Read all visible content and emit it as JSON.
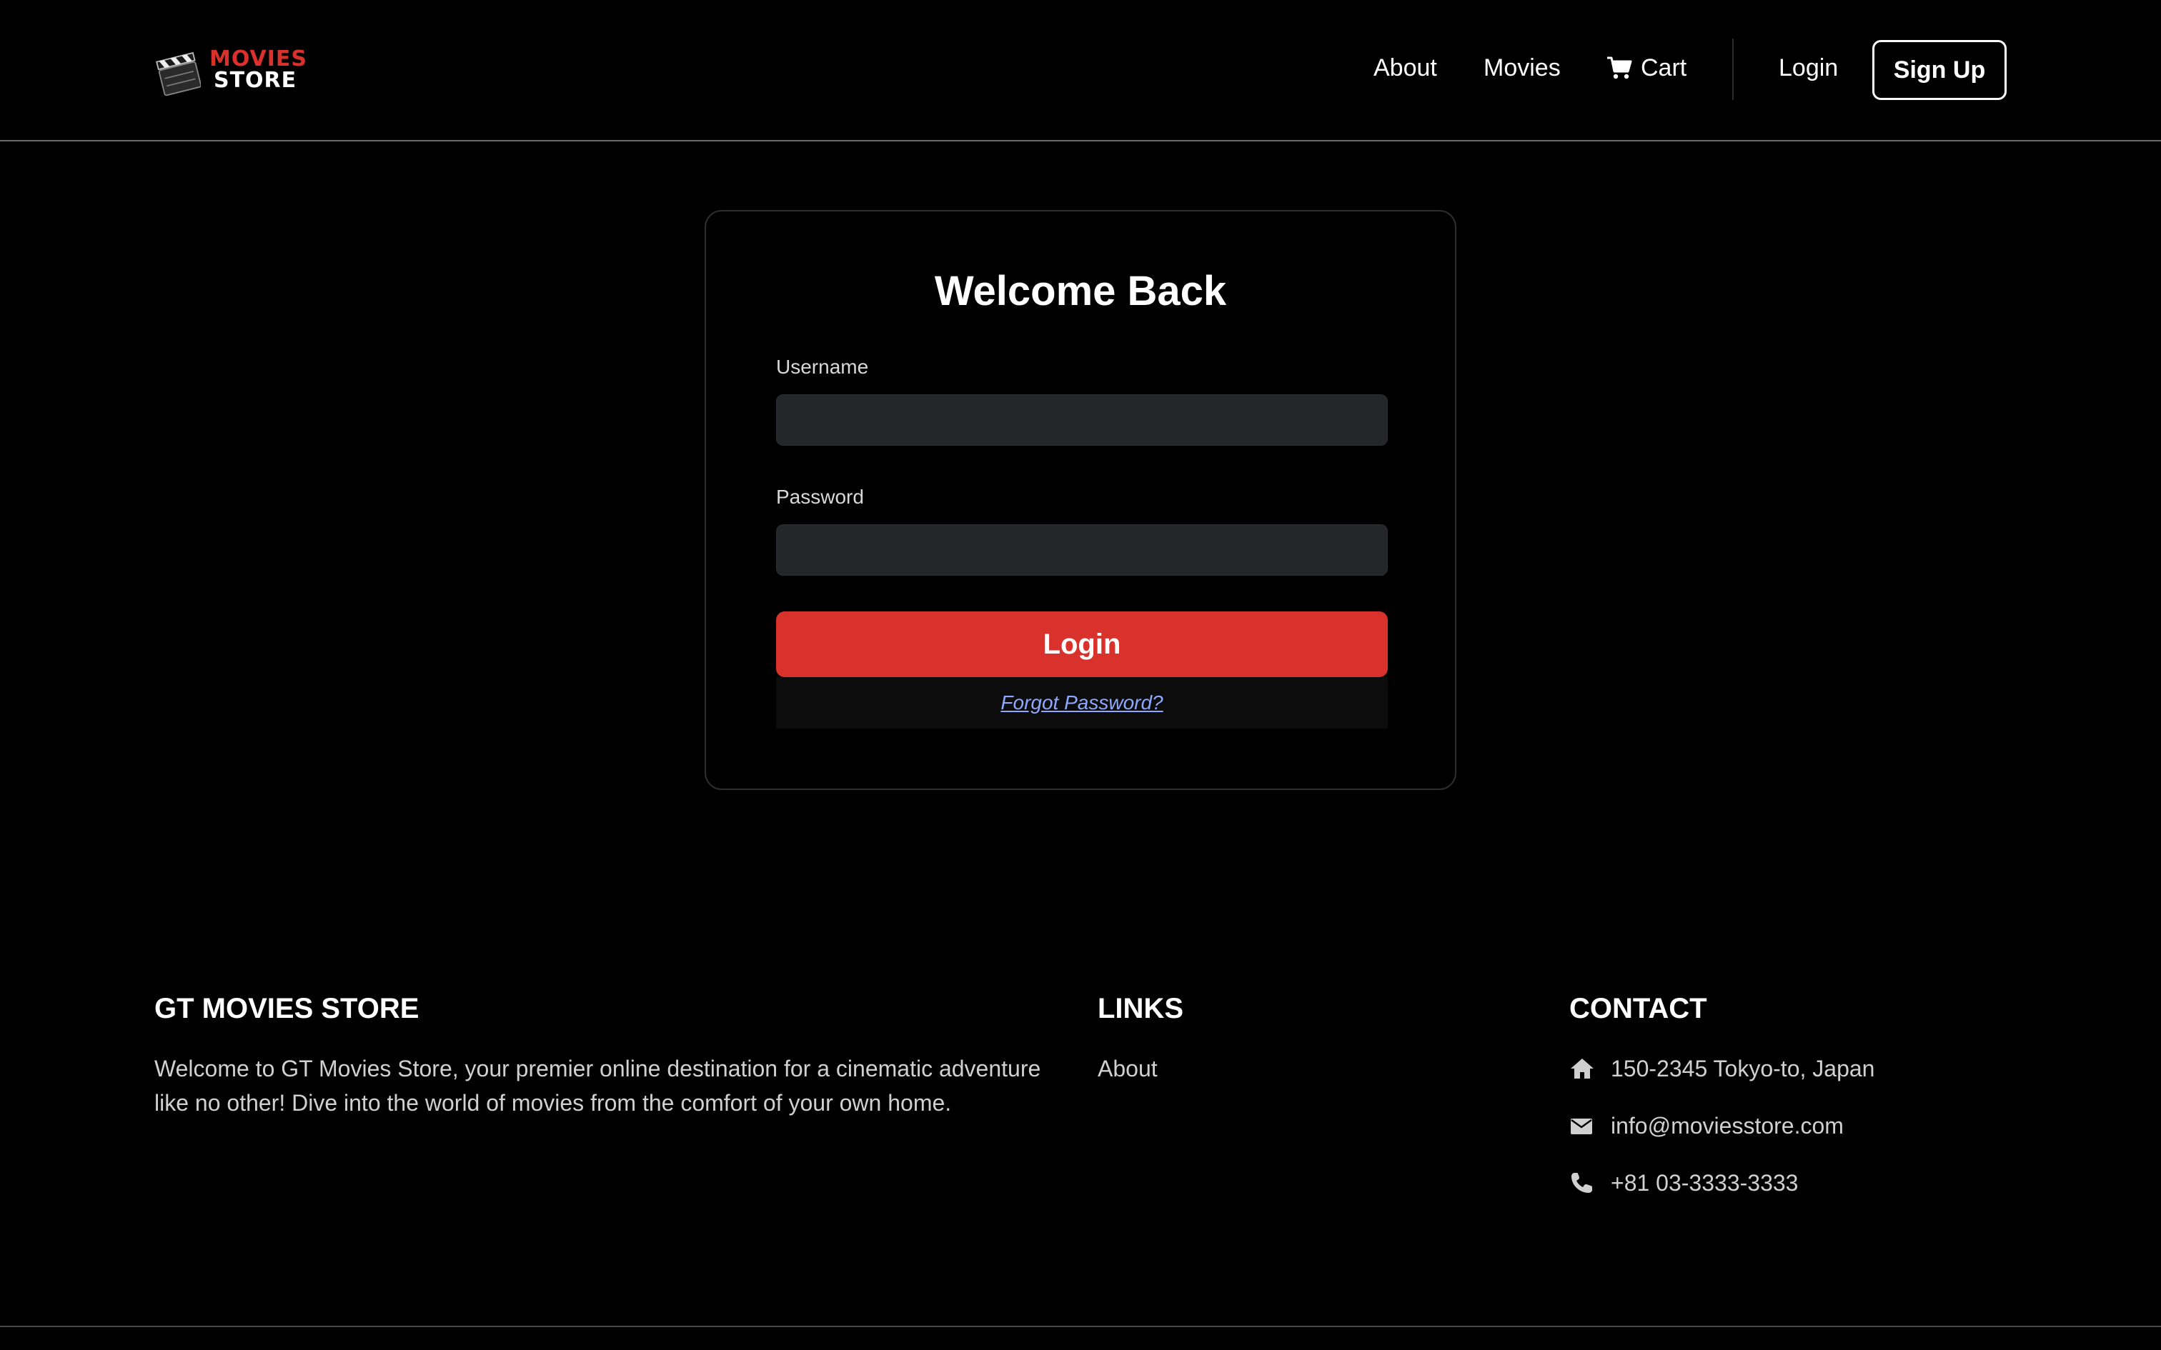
{
  "brand": {
    "line1": "MOVIES",
    "line2": "STORE",
    "accent_color": "#d9302b"
  },
  "nav": {
    "about": "About",
    "movies": "Movies",
    "cart": "Cart",
    "cart_icon": "cart-icon",
    "login": "Login",
    "signup": "Sign Up"
  },
  "login_form": {
    "title": "Welcome Back",
    "username_label": "Username",
    "username_value": "",
    "password_label": "Password",
    "password_value": "",
    "submit": "Login",
    "forgot": "Forgot Password?",
    "button_color": "#d9312b"
  },
  "footer": {
    "store_heading": "GT MOVIES STORE",
    "store_description": "Welcome to GT Movies Store, your premier online destination for a cinematic adventure like no other! Dive into the world of movies from the comfort of your own home.",
    "links_heading": "LINKS",
    "links": [
      "About"
    ],
    "contact_heading": "CONTACT",
    "contact": {
      "address": "150-2345 Tokyo-to, Japan",
      "address_icon": "home-icon",
      "email": "info@moviesstore.com",
      "email_icon": "envelope-icon",
      "phone": "+81 03-3333-3333",
      "phone_icon": "phone-icon"
    }
  }
}
